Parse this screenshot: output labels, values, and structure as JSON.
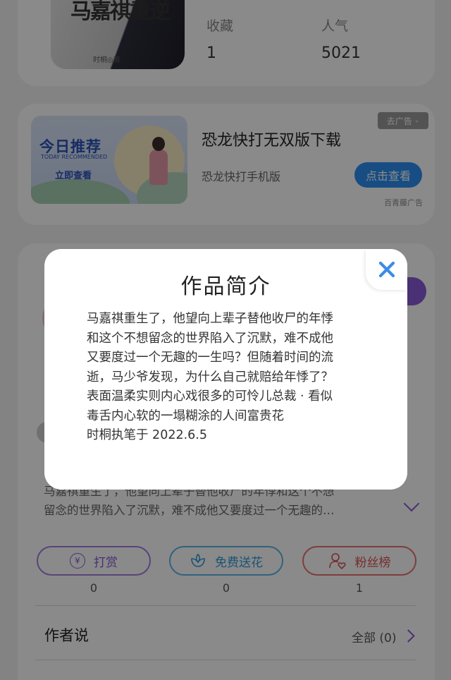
{
  "book": {
    "cover_title": "马嘉祺重逆",
    "cover_author": "时桐◎著",
    "stats": [
      {
        "label": "收藏",
        "value": "1"
      },
      {
        "label": "人气",
        "value": "5021"
      }
    ]
  },
  "ad": {
    "banner_headline": "今日推荐",
    "banner_sub": "TODAY RECOMMENDED",
    "banner_cta": "立即查看",
    "title": "恐龙快打无双版下载",
    "subtitle": "恐龙快打手机版",
    "dismiss_label": "去广告",
    "button_label": "点击查看",
    "source": "百青藤广告"
  },
  "intro_preview": {
    "line1": "马嘉祺重生了，他望向上辈子替他收尸的年悸和这个不想",
    "line2": "留念的世界陷入了沉默，难不成他又要度过一个无趣的…"
  },
  "actions": [
    {
      "label": "打赏",
      "icon": "yen-coin-icon",
      "count": "0"
    },
    {
      "label": "免费送花",
      "icon": "flower-icon",
      "count": "0"
    },
    {
      "label": "粉丝榜",
      "icon": "user-heart-icon",
      "count": "1"
    }
  ],
  "author_section": {
    "title": "作者说",
    "all_label": "全部 (0)"
  },
  "modal": {
    "title": "作品简介",
    "lines": [
      "马嘉祺重生了，他望向上辈子替他收尸的年悸",
      "和这个不想留念的世界陷入了沉默，难不成他",
      "又要度过一个无趣的一生吗？但随着时间的流",
      "逝，马少爷发现，为什么自己就赔给年悸了？",
      "表面温柔实则内心戏很多的可怜儿总裁 · 看似",
      "毒舌内心软的一塌糊涂的人间富贵花",
      "时桐执笔于 2022.6.5"
    ]
  },
  "colors": {
    "accent_purple": "#8a5ad6",
    "accent_blue": "#2c8ff2",
    "accent_red": "#de5050",
    "close_blue": "#3c8be8"
  }
}
